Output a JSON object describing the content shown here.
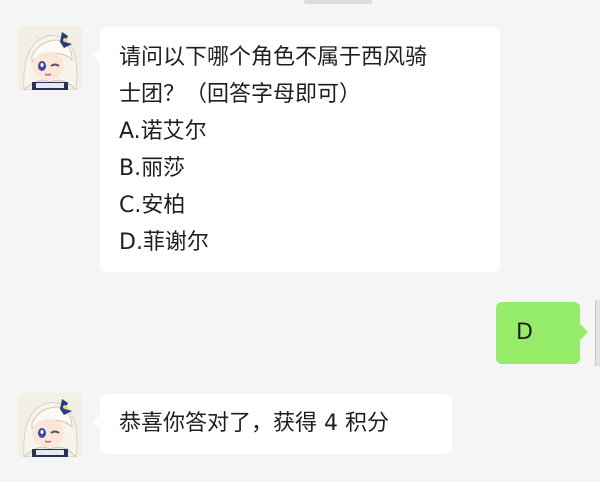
{
  "messages": [
    {
      "sender": "bot",
      "avatar_icon": "paimon-avatar-icon",
      "lines": [
        "请问以下哪个角色不属于西风骑",
        "士团？（回答字母即可）",
        "A.诺艾尔",
        "B.丽莎",
        "C.安柏",
        "D.菲谢尔"
      ]
    },
    {
      "sender": "user",
      "text": "D"
    },
    {
      "sender": "bot",
      "avatar_icon": "paimon-avatar-icon",
      "text": "恭喜你答对了，获得 4 积分"
    }
  ],
  "colors": {
    "background": "#f5f5f5",
    "bot_bubble": "#ffffff",
    "user_bubble": "#95ec69",
    "text": "#1f1f1f"
  }
}
